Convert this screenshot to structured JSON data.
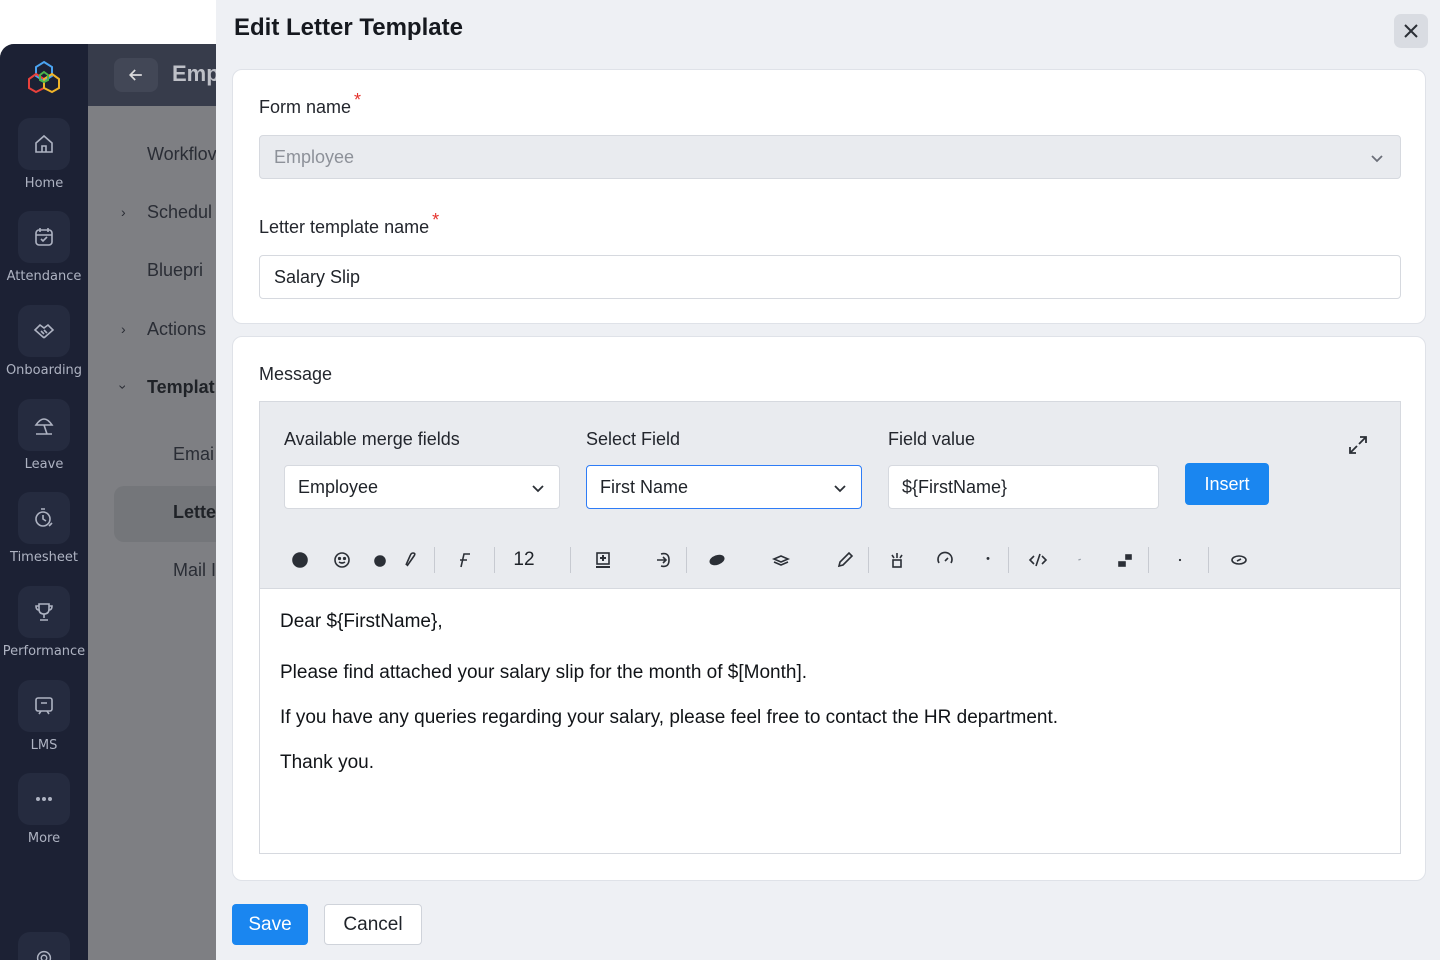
{
  "rail": {
    "items": [
      {
        "label": "Home",
        "icon": "home-icon"
      },
      {
        "label": "Attendance",
        "icon": "calendar-check-icon"
      },
      {
        "label": "Onboarding",
        "icon": "handshake-icon"
      },
      {
        "label": "Leave",
        "icon": "beach-umbrella-icon"
      },
      {
        "label": "Timesheet",
        "icon": "timer-icon"
      },
      {
        "label": "Performance",
        "icon": "trophy-icon"
      },
      {
        "label": "LMS",
        "icon": "board-icon"
      },
      {
        "label": "More",
        "icon": "more-dots-icon"
      }
    ]
  },
  "background": {
    "title": "Emp",
    "menu": [
      "Workflov",
      "Schedul",
      "Bluepri",
      "Actions",
      "Templat",
      "Emai",
      "Lette",
      "Mail I"
    ]
  },
  "modal": {
    "title": "Edit Letter Template",
    "form_name": {
      "label": "Form name",
      "value": "Employee"
    },
    "template_name": {
      "label": "Letter template name",
      "value": "Salary Slip"
    },
    "required_mark": "*",
    "message": {
      "label": "Message",
      "merge_fields_label": "Available merge fields",
      "merge_fields_value": "Employee",
      "select_field_label": "Select Field",
      "select_field_value": "First Name",
      "field_value_label": "Field value",
      "field_value": "${FirstName}",
      "insert_label": "Insert",
      "font_size": "12"
    },
    "body": {
      "p1": "Dear ${FirstName},",
      "p2": "Please find attached your salary slip for the month of $[Month].",
      "p3": "If you have any queries regarding your salary, please feel free to contact the HR department.",
      "p4": "Thank you."
    },
    "save_label": "Save",
    "cancel_label": "Cancel"
  },
  "colors": {
    "accent": "#1a86f0",
    "required": "#e5322c",
    "rail": "#1c2134"
  }
}
